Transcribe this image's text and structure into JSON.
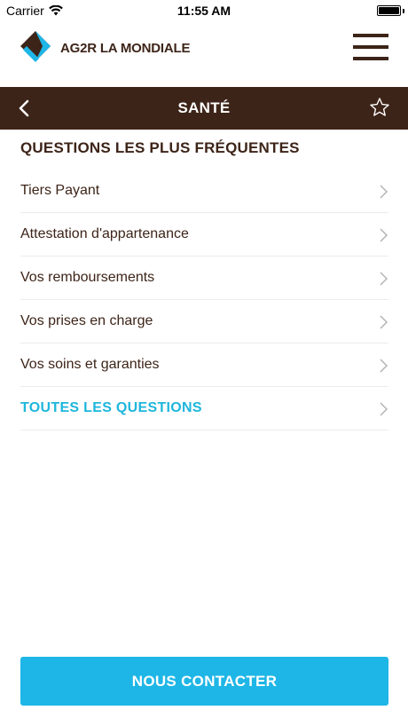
{
  "status_bar": {
    "carrier": "Carrier",
    "time": "11:55 AM"
  },
  "header": {
    "brand_name": "AG2R LA MONDIALE",
    "menu_icon": "hamburger-menu-icon"
  },
  "nav": {
    "title": "SANTÉ",
    "back_icon": "chevron-left-icon",
    "favorite_icon": "star-outline-icon"
  },
  "faq": {
    "title": "QUESTIONS LES PLUS FRÉQUENTES",
    "items": [
      {
        "label": "Tiers Payant"
      },
      {
        "label": "Attestation d'appartenance"
      },
      {
        "label": "Vos remboursements"
      },
      {
        "label": "Vos prises en charge"
      },
      {
        "label": "Vos soins et garanties"
      }
    ],
    "all_label": "TOUTES LES QUESTIONS"
  },
  "contact": {
    "label": "NOUS CONTACTER"
  },
  "colors": {
    "brown": "#3d2418",
    "cyan": "#1eb6e6",
    "link_cyan": "#1eb6dc"
  }
}
